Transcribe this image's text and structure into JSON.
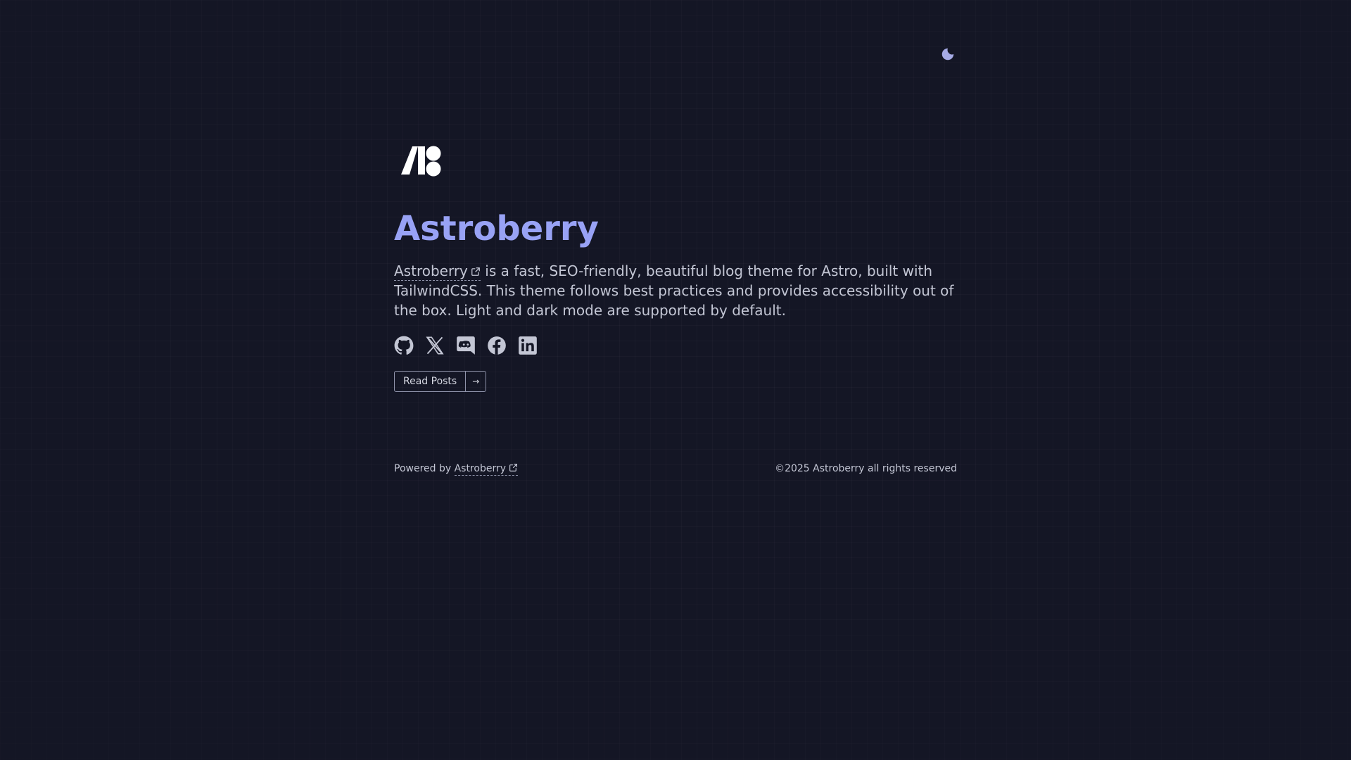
{
  "theme_toggle": {
    "icon": "moon-icon"
  },
  "hero": {
    "logo_icon": "astroberry-logo",
    "title": "Astroberry",
    "description": {
      "link_text": "Astroberry",
      "text": "is a fast, SEO-friendly, beautiful blog theme for Astro, built with TailwindCSS. This theme follows best practices and provides accessibility out of the box. Light and dark mode are supported by default."
    },
    "socials": [
      {
        "icon": "github-icon"
      },
      {
        "icon": "x-icon"
      },
      {
        "icon": "discord-icon"
      },
      {
        "icon": "facebook-icon"
      },
      {
        "icon": "linkedin-icon"
      }
    ],
    "read_posts": {
      "label": "Read Posts",
      "arrow": "→"
    }
  },
  "footer": {
    "powered_by": "Powered by",
    "powered_link": "Astroberry",
    "copyright": "©2025 Astroberry all rights reserved"
  },
  "colors": {
    "background": "#141625",
    "accent": "#98a2f5",
    "text": "#c3c6d4"
  }
}
